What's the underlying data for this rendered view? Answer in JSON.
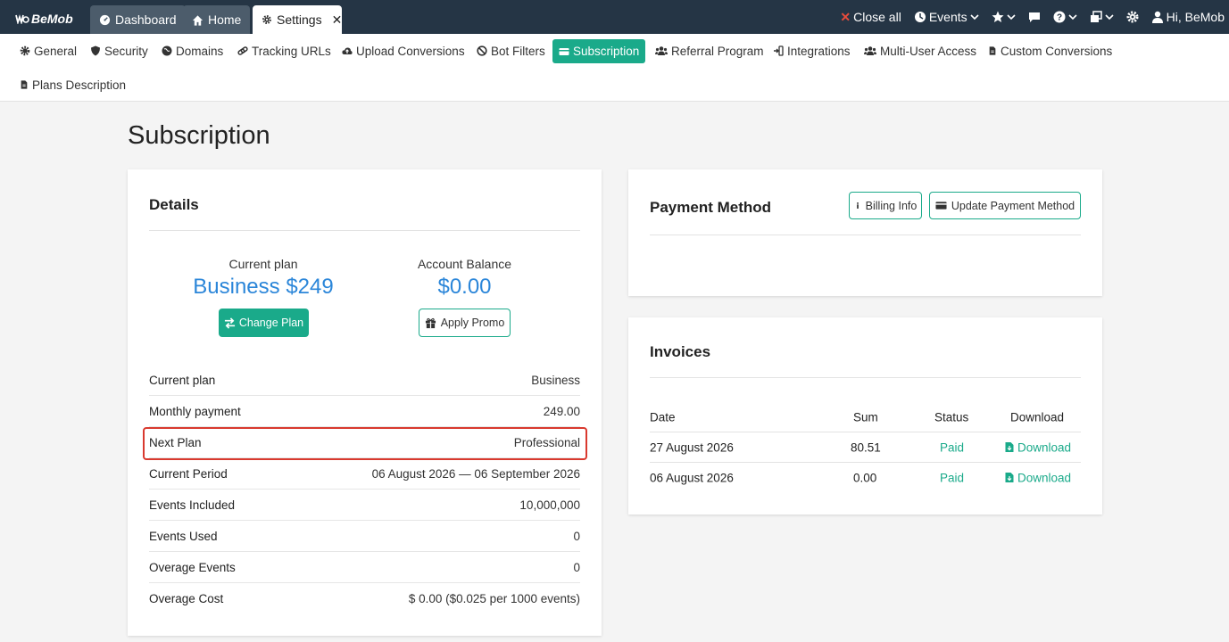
{
  "app": {
    "logo_text": "BeMob"
  },
  "tabs": [
    {
      "label": "Dashboard",
      "icon": "dashboard-icon"
    },
    {
      "label": "Home",
      "icon": "home-icon"
    },
    {
      "label": "Settings",
      "icon": "gear-icon",
      "close": "✕"
    }
  ],
  "topbar": {
    "close_all": "Close all",
    "events": "Events",
    "greeting": "Hi, BeMob"
  },
  "nav": {
    "items": [
      {
        "label": "General",
        "icon": "gear-icon"
      },
      {
        "label": "Security",
        "icon": "shield-icon"
      },
      {
        "label": "Domains",
        "icon": "globe-icon"
      },
      {
        "label": "Tracking URLs",
        "icon": "link-icon"
      },
      {
        "label": "Upload Conversions",
        "icon": "cloud-upload-icon"
      },
      {
        "label": "Bot Filters",
        "icon": "ban-icon"
      },
      {
        "label": "Subscription",
        "icon": "credit-card-icon"
      },
      {
        "label": "Referral Program",
        "icon": "users-icon"
      },
      {
        "label": "Integrations",
        "icon": "plug-icon"
      },
      {
        "label": "Multi-User Access",
        "icon": "users-icon"
      },
      {
        "label": "Custom Conversions",
        "icon": "file-icon"
      },
      {
        "label": "Plans Description",
        "icon": "file-icon"
      }
    ]
  },
  "page": {
    "title": "Subscription"
  },
  "details": {
    "title": "Details",
    "current_plan_label": "Current plan",
    "current_plan_value": "Business $249",
    "change_plan_button": "Change Plan",
    "balance_label": "Account Balance",
    "balance_value": "$0.00",
    "apply_promo_button": "Apply Promo",
    "rows": [
      {
        "label": "Current plan",
        "value": "Business"
      },
      {
        "label": "Monthly payment",
        "value": "249.00"
      },
      {
        "label": "Next Plan",
        "value": "Professional"
      },
      {
        "label": "Current Period",
        "value": "06 August 2026 — 06 September 2026"
      },
      {
        "label": "Events Included",
        "value": "10,000,000"
      },
      {
        "label": "Events Used",
        "value": "0"
      },
      {
        "label": "Overage Events",
        "value": "0"
      },
      {
        "label": "Overage Cost",
        "value": "$ 0.00 ($0.025 per 1000 events)"
      }
    ]
  },
  "payment": {
    "title": "Payment Method",
    "billing_info_button": "Billing Info",
    "update_button": "Update Payment Method"
  },
  "invoices": {
    "title": "Invoices",
    "headers": {
      "date": "Date",
      "sum": "Sum",
      "status": "Status",
      "download": "Download"
    },
    "rows": [
      {
        "date": "27 August 2026",
        "sum": "80.51",
        "status": "Paid",
        "download": "Download"
      },
      {
        "date": "06 August 2026",
        "sum": "0.00",
        "status": "Paid",
        "download": "Download"
      }
    ]
  },
  "colors": {
    "accent": "#1aaa8a",
    "topbar": "#253545",
    "link_blue": "#2b86d9",
    "highlight": "#d9392e"
  }
}
